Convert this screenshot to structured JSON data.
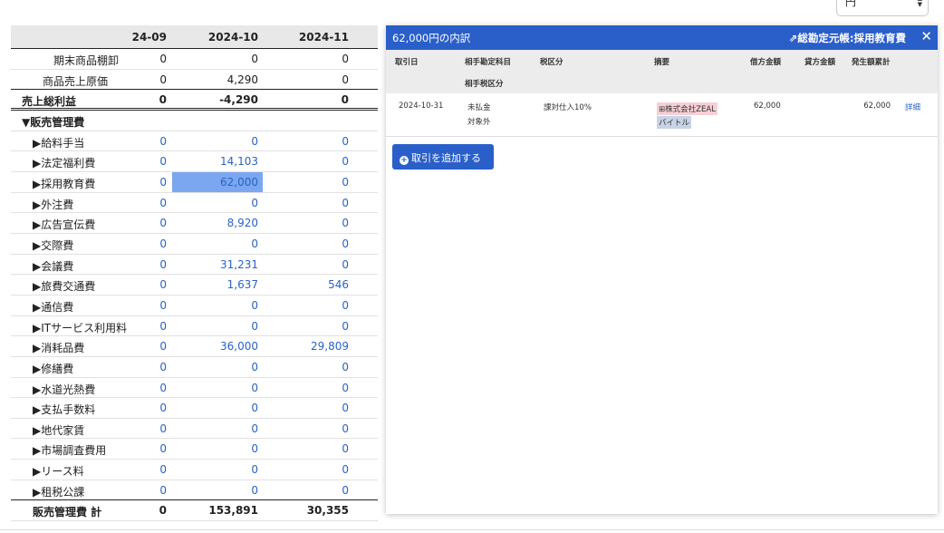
{
  "currency_select": {
    "value": "円"
  },
  "report": {
    "columns": [
      "24-09",
      "2024-10",
      "2024-11"
    ],
    "rows": [
      {
        "label": "期末商品棚卸",
        "v": [
          "0",
          "0",
          "0"
        ]
      },
      {
        "label": "商品売上原価",
        "v": [
          "0",
          "4,290",
          "0"
        ]
      },
      {
        "label": "売上総利益",
        "v": [
          "0",
          "-4,290",
          "0"
        ]
      },
      {
        "label": "▼販売管理費",
        "v": [
          "",
          "",
          ""
        ]
      },
      {
        "label": "▶給料手当",
        "v": [
          "0",
          "0",
          "0"
        ]
      },
      {
        "label": "▶法定福利費",
        "v": [
          "0",
          "14,103",
          "0"
        ]
      },
      {
        "label": "▶採用教育費",
        "v": [
          "0",
          "62,000",
          "0"
        ]
      },
      {
        "label": "▶外注費",
        "v": [
          "0",
          "0",
          "0"
        ]
      },
      {
        "label": "▶広告宣伝費",
        "v": [
          "0",
          "8,920",
          "0"
        ]
      },
      {
        "label": "▶交際費",
        "v": [
          "0",
          "0",
          "0"
        ]
      },
      {
        "label": "▶会議費",
        "v": [
          "0",
          "31,231",
          "0"
        ]
      },
      {
        "label": "▶旅費交通費",
        "v": [
          "0",
          "1,637",
          "546"
        ]
      },
      {
        "label": "▶通信費",
        "v": [
          "0",
          "0",
          "0"
        ]
      },
      {
        "label": "▶ITサービス利用料",
        "v": [
          "0",
          "0",
          "0"
        ]
      },
      {
        "label": "▶消耗品費",
        "v": [
          "0",
          "36,000",
          "29,809"
        ]
      },
      {
        "label": "▶修繕費",
        "v": [
          "0",
          "0",
          "0"
        ]
      },
      {
        "label": "▶水道光熱費",
        "v": [
          "0",
          "0",
          "0"
        ]
      },
      {
        "label": "▶支払手数料",
        "v": [
          "0",
          "0",
          "0"
        ]
      },
      {
        "label": "▶地代家賃",
        "v": [
          "0",
          "0",
          "0"
        ]
      },
      {
        "label": "▶市場調査費用",
        "v": [
          "0",
          "0",
          "0"
        ]
      },
      {
        "label": "▶リース料",
        "v": [
          "0",
          "0",
          "0"
        ]
      },
      {
        "label": "▶租税公課",
        "v": [
          "0",
          "0",
          "0"
        ]
      },
      {
        "label": "販売管理費 計",
        "v": [
          "0",
          "153,891",
          "30,355"
        ]
      }
    ]
  },
  "panel": {
    "title": "62,000円の内訳",
    "ledger_link": "総勘定元帳:採用教育費",
    "close": "✕",
    "headers": {
      "date": "取引日",
      "counter_account": "相手勘定科目",
      "counter_tax": "相手税区分",
      "tax": "税区分",
      "description": "摘要",
      "debit": "借方金額",
      "credit": "貸方金額",
      "cumulative": "発生額累計"
    },
    "transaction": {
      "date": "2024-10-31",
      "counter_account": "未払金",
      "counter_tax": "対象外",
      "tax": "課対仕入10%",
      "partner": "株式会社ZEAL",
      "item_tag": "バイトル",
      "debit": "62,000",
      "credit": "",
      "cumulative": "62,000",
      "detail_link": "詳細"
    },
    "add_button": "取引を追加する"
  }
}
